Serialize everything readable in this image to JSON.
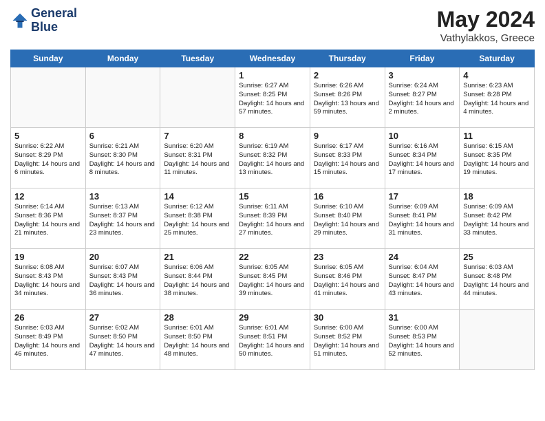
{
  "header": {
    "logo_line1": "General",
    "logo_line2": "Blue",
    "month": "May 2024",
    "location": "Vathylakkos, Greece"
  },
  "days_of_week": [
    "Sunday",
    "Monday",
    "Tuesday",
    "Wednesday",
    "Thursday",
    "Friday",
    "Saturday"
  ],
  "weeks": [
    [
      {
        "day": "",
        "sunrise": "",
        "sunset": "",
        "daylight": ""
      },
      {
        "day": "",
        "sunrise": "",
        "sunset": "",
        "daylight": ""
      },
      {
        "day": "",
        "sunrise": "",
        "sunset": "",
        "daylight": ""
      },
      {
        "day": "1",
        "sunrise": "Sunrise: 6:27 AM",
        "sunset": "Sunset: 8:25 PM",
        "daylight": "Daylight: 14 hours and 57 minutes."
      },
      {
        "day": "2",
        "sunrise": "Sunrise: 6:26 AM",
        "sunset": "Sunset: 8:26 PM",
        "daylight": "Daylight: 13 hours and 59 minutes."
      },
      {
        "day": "3",
        "sunrise": "Sunrise: 6:24 AM",
        "sunset": "Sunset: 8:27 PM",
        "daylight": "Daylight: 14 hours and 2 minutes."
      },
      {
        "day": "4",
        "sunrise": "Sunrise: 6:23 AM",
        "sunset": "Sunset: 8:28 PM",
        "daylight": "Daylight: 14 hours and 4 minutes."
      }
    ],
    [
      {
        "day": "5",
        "sunrise": "Sunrise: 6:22 AM",
        "sunset": "Sunset: 8:29 PM",
        "daylight": "Daylight: 14 hours and 6 minutes."
      },
      {
        "day": "6",
        "sunrise": "Sunrise: 6:21 AM",
        "sunset": "Sunset: 8:30 PM",
        "daylight": "Daylight: 14 hours and 8 minutes."
      },
      {
        "day": "7",
        "sunrise": "Sunrise: 6:20 AM",
        "sunset": "Sunset: 8:31 PM",
        "daylight": "Daylight: 14 hours and 11 minutes."
      },
      {
        "day": "8",
        "sunrise": "Sunrise: 6:19 AM",
        "sunset": "Sunset: 8:32 PM",
        "daylight": "Daylight: 14 hours and 13 minutes."
      },
      {
        "day": "9",
        "sunrise": "Sunrise: 6:17 AM",
        "sunset": "Sunset: 8:33 PM",
        "daylight": "Daylight: 14 hours and 15 minutes."
      },
      {
        "day": "10",
        "sunrise": "Sunrise: 6:16 AM",
        "sunset": "Sunset: 8:34 PM",
        "daylight": "Daylight: 14 hours and 17 minutes."
      },
      {
        "day": "11",
        "sunrise": "Sunrise: 6:15 AM",
        "sunset": "Sunset: 8:35 PM",
        "daylight": "Daylight: 14 hours and 19 minutes."
      }
    ],
    [
      {
        "day": "12",
        "sunrise": "Sunrise: 6:14 AM",
        "sunset": "Sunset: 8:36 PM",
        "daylight": "Daylight: 14 hours and 21 minutes."
      },
      {
        "day": "13",
        "sunrise": "Sunrise: 6:13 AM",
        "sunset": "Sunset: 8:37 PM",
        "daylight": "Daylight: 14 hours and 23 minutes."
      },
      {
        "day": "14",
        "sunrise": "Sunrise: 6:12 AM",
        "sunset": "Sunset: 8:38 PM",
        "daylight": "Daylight: 14 hours and 25 minutes."
      },
      {
        "day": "15",
        "sunrise": "Sunrise: 6:11 AM",
        "sunset": "Sunset: 8:39 PM",
        "daylight": "Daylight: 14 hours and 27 minutes."
      },
      {
        "day": "16",
        "sunrise": "Sunrise: 6:10 AM",
        "sunset": "Sunset: 8:40 PM",
        "daylight": "Daylight: 14 hours and 29 minutes."
      },
      {
        "day": "17",
        "sunrise": "Sunrise: 6:09 AM",
        "sunset": "Sunset: 8:41 PM",
        "daylight": "Daylight: 14 hours and 31 minutes."
      },
      {
        "day": "18",
        "sunrise": "Sunrise: 6:09 AM",
        "sunset": "Sunset: 8:42 PM",
        "daylight": "Daylight: 14 hours and 33 minutes."
      }
    ],
    [
      {
        "day": "19",
        "sunrise": "Sunrise: 6:08 AM",
        "sunset": "Sunset: 8:43 PM",
        "daylight": "Daylight: 14 hours and 34 minutes."
      },
      {
        "day": "20",
        "sunrise": "Sunrise: 6:07 AM",
        "sunset": "Sunset: 8:43 PM",
        "daylight": "Daylight: 14 hours and 36 minutes."
      },
      {
        "day": "21",
        "sunrise": "Sunrise: 6:06 AM",
        "sunset": "Sunset: 8:44 PM",
        "daylight": "Daylight: 14 hours and 38 minutes."
      },
      {
        "day": "22",
        "sunrise": "Sunrise: 6:05 AM",
        "sunset": "Sunset: 8:45 PM",
        "daylight": "Daylight: 14 hours and 39 minutes."
      },
      {
        "day": "23",
        "sunrise": "Sunrise: 6:05 AM",
        "sunset": "Sunset: 8:46 PM",
        "daylight": "Daylight: 14 hours and 41 minutes."
      },
      {
        "day": "24",
        "sunrise": "Sunrise: 6:04 AM",
        "sunset": "Sunset: 8:47 PM",
        "daylight": "Daylight: 14 hours and 43 minutes."
      },
      {
        "day": "25",
        "sunrise": "Sunrise: 6:03 AM",
        "sunset": "Sunset: 8:48 PM",
        "daylight": "Daylight: 14 hours and 44 minutes."
      }
    ],
    [
      {
        "day": "26",
        "sunrise": "Sunrise: 6:03 AM",
        "sunset": "Sunset: 8:49 PM",
        "daylight": "Daylight: 14 hours and 46 minutes."
      },
      {
        "day": "27",
        "sunrise": "Sunrise: 6:02 AM",
        "sunset": "Sunset: 8:50 PM",
        "daylight": "Daylight: 14 hours and 47 minutes."
      },
      {
        "day": "28",
        "sunrise": "Sunrise: 6:01 AM",
        "sunset": "Sunset: 8:50 PM",
        "daylight": "Daylight: 14 hours and 48 minutes."
      },
      {
        "day": "29",
        "sunrise": "Sunrise: 6:01 AM",
        "sunset": "Sunset: 8:51 PM",
        "daylight": "Daylight: 14 hours and 50 minutes."
      },
      {
        "day": "30",
        "sunrise": "Sunrise: 6:00 AM",
        "sunset": "Sunset: 8:52 PM",
        "daylight": "Daylight: 14 hours and 51 minutes."
      },
      {
        "day": "31",
        "sunrise": "Sunrise: 6:00 AM",
        "sunset": "Sunset: 8:53 PM",
        "daylight": "Daylight: 14 hours and 52 minutes."
      },
      {
        "day": "",
        "sunrise": "",
        "sunset": "",
        "daylight": ""
      }
    ]
  ]
}
